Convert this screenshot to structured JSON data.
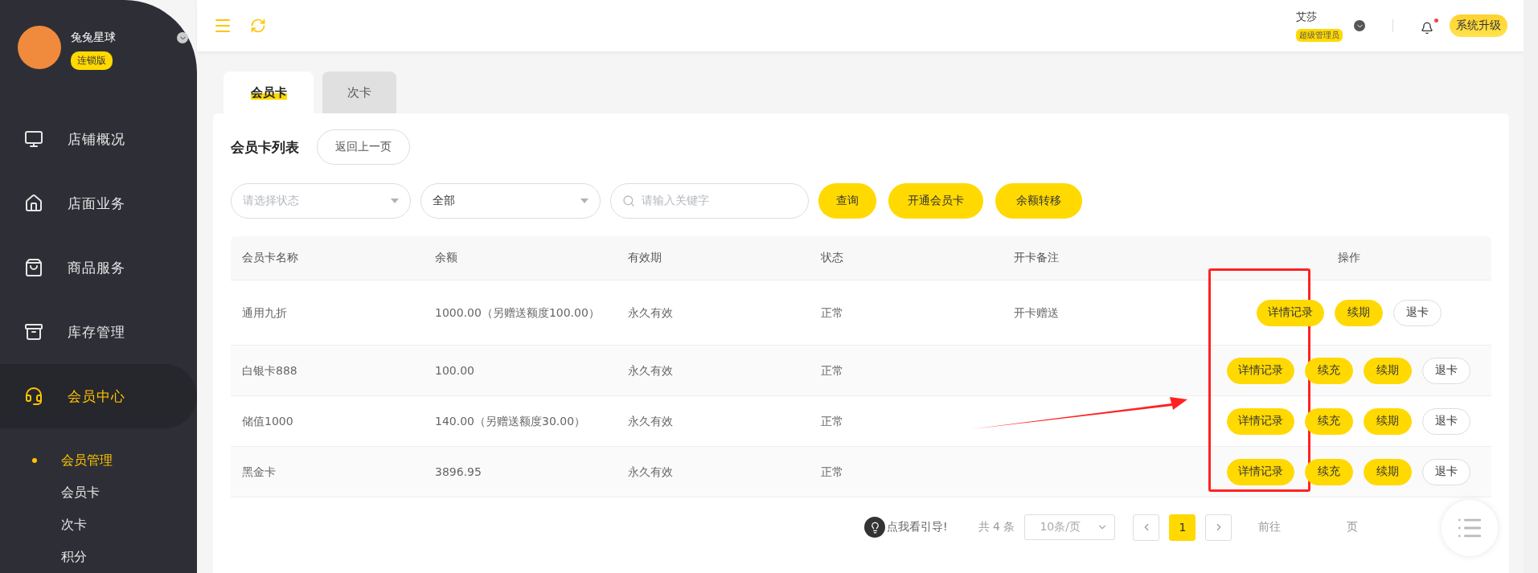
{
  "sidebar": {
    "brand": {
      "name": "兔兔星球",
      "edition": "连锁版"
    },
    "items": [
      {
        "label": "店铺概况",
        "selected": false
      },
      {
        "label": "店面业务",
        "selected": false
      },
      {
        "label": "商品服务",
        "selected": false
      },
      {
        "label": "库存管理",
        "selected": false
      },
      {
        "label": "会员中心",
        "selected": true
      }
    ],
    "subitems": [
      {
        "label": "会员管理",
        "selected": true
      },
      {
        "label": "会员卡",
        "selected": false
      },
      {
        "label": "次卡",
        "selected": false
      },
      {
        "label": "积分",
        "selected": false
      }
    ]
  },
  "header": {
    "user": {
      "name": "艾莎",
      "role": "超级管理员"
    },
    "notification_dot": true,
    "upgrade": "系统升级"
  },
  "tabs": [
    {
      "label": "会员卡",
      "selected": true
    },
    {
      "label": "次卡",
      "selected": false
    }
  ],
  "panel": {
    "title": "会员卡列表",
    "back": "返回上一页"
  },
  "filters": {
    "status": {
      "placeholder": "请选择状态"
    },
    "type": {
      "value": "全部"
    },
    "search": {
      "placeholder": "请输入关键字"
    },
    "buttons": [
      "查询",
      "开通会员卡",
      "余额转移"
    ]
  },
  "table": {
    "columns": [
      "会员卡名称",
      "余额",
      "有效期",
      "状态",
      "开卡备注",
      "操作"
    ],
    "rows": [
      {
        "cells": [
          "通用九折",
          "1000.00（另赠送额度100.00）",
          "永久有效",
          "正常",
          "开卡赠送"
        ],
        "actions": [
          {
            "label": "详情记录",
            "kind": "primary"
          },
          {
            "label": "续期",
            "kind": "primary"
          },
          {
            "label": "退卡",
            "kind": "outline"
          }
        ]
      },
      {
        "cells": [
          "白银卡888",
          "100.00",
          "永久有效",
          "正常",
          ""
        ],
        "actions": [
          {
            "label": "详情记录",
            "kind": "primary"
          },
          {
            "label": "续充",
            "kind": "primary"
          },
          {
            "label": "续期",
            "kind": "primary"
          },
          {
            "label": "退卡",
            "kind": "outline"
          }
        ]
      },
      {
        "cells": [
          "储值1000",
          "140.00（另赠送额度30.00）",
          "永久有效",
          "正常",
          ""
        ],
        "actions": [
          {
            "label": "详情记录",
            "kind": "primary"
          },
          {
            "label": "续充",
            "kind": "primary"
          },
          {
            "label": "续期",
            "kind": "primary"
          },
          {
            "label": "退卡",
            "kind": "outline"
          }
        ]
      },
      {
        "cells": [
          "黑金卡",
          "3896.95",
          "永久有效",
          "正常",
          ""
        ],
        "actions": [
          {
            "label": "详情记录",
            "kind": "primary"
          },
          {
            "label": "续充",
            "kind": "primary"
          },
          {
            "label": "续期",
            "kind": "primary"
          },
          {
            "label": "退卡",
            "kind": "outline"
          }
        ]
      }
    ]
  },
  "pagination": {
    "guide": "点我看引导!",
    "total": "共 4 条",
    "page_size": "10条/页",
    "pages": [
      {
        "label": "1",
        "selected": true
      }
    ],
    "goto": "前往",
    "goto_suffix": "页"
  }
}
